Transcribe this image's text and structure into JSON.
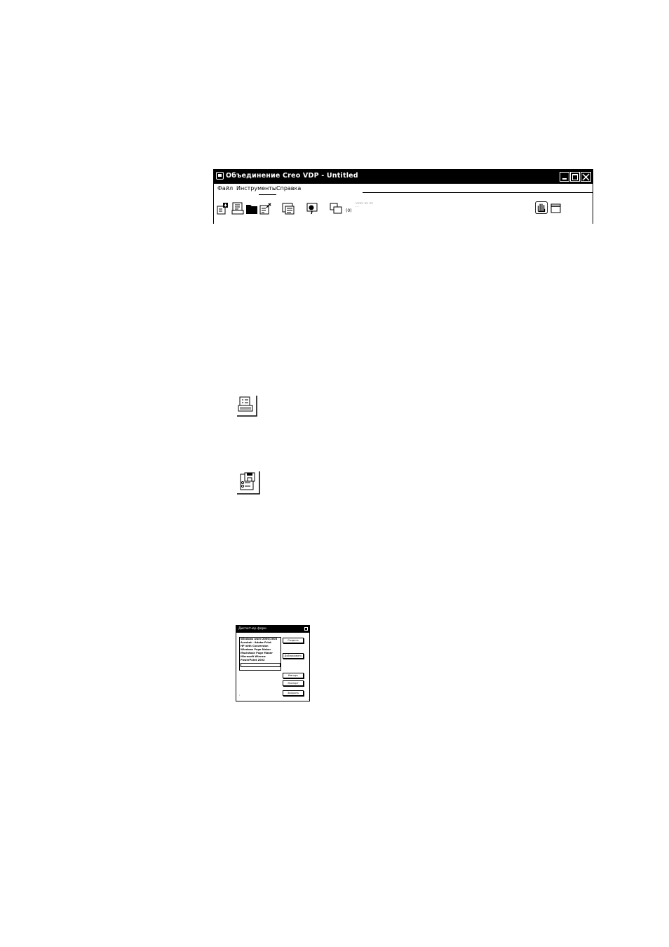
{
  "window": {
    "title": "Объединение Creo VDP - Untitled",
    "menu": [
      "Файл",
      "Инструменты",
      "Справка"
    ],
    "toolbar": {
      "icons": [
        "add-data-source-icon",
        "forms-icon",
        "folder-icon",
        "edit-form-icon",
        "list-view-icon",
        "print-preview-icon",
        "copy-layers-icon",
        "hand-tool-icon",
        "window-icon"
      ],
      "count_label": "(0)",
      "status_line1": "ᴗᴗᴗᴗ ᴗᴗ ᴗᴗ",
      "status_line2": "· ·"
    }
  },
  "forms_manager": {
    "title": "Диспетчер форм",
    "list_items": [
      "Windows word 2000/2003",
      "Acrobat - Adobe Print",
      "HP with Conversion",
      "Windows Page Maker",
      "MacIntosh Page Maker",
      "Microsoft Winrow",
      "PowerPoint 2002"
    ],
    "buttons": [
      "Создать",
      "Дублировать",
      "Импорт",
      "Экспорт",
      "Закрыть"
    ],
    "footer_mark": "r",
    "grip_mark": "⌟"
  }
}
